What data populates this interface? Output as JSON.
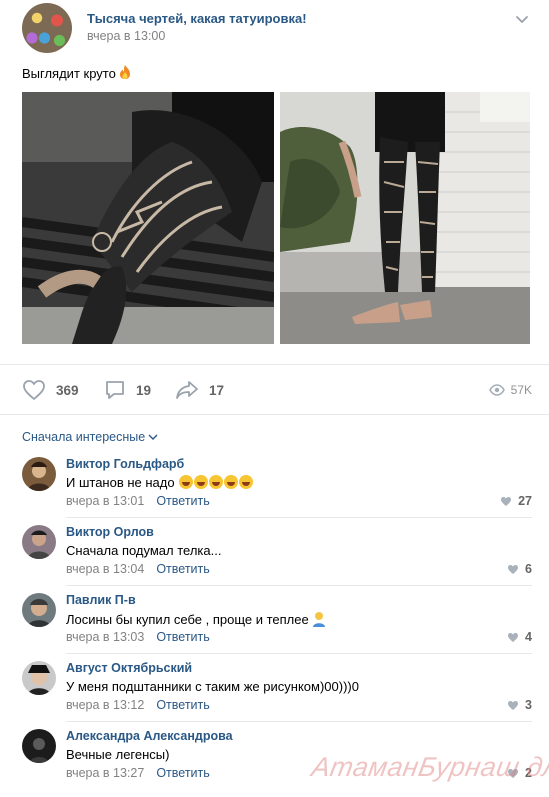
{
  "post": {
    "group_name": "Тысяча чертей, какая татуировка!",
    "time": "вчера в 13:00",
    "text": "Выглядит круто",
    "text_emoji": "fire-emoji"
  },
  "actions": {
    "likes": "369",
    "comments": "19",
    "shares": "17",
    "views": "57K"
  },
  "comments_sort": "Сначала интересные",
  "comments": [
    {
      "author": "Виктор Гольдфарб",
      "text": "И штанов не надо",
      "emojis": 5,
      "time": "вчера в 13:01",
      "reply": "Ответить",
      "likes": "27"
    },
    {
      "author": "Виктор Орлов",
      "text": "Сначала подумал телка...",
      "time": "вчера в 13:04",
      "reply": "Ответить",
      "likes": "6"
    },
    {
      "author": "Павлик П-в",
      "text": "Лосины бы купил себе , проще и теплее",
      "time": "вчера в 13:03",
      "reply": "Ответить",
      "likes": "4"
    },
    {
      "author": "Август Октябрьский",
      "text": "У меня подштанники с таким же рисунком)00)))0",
      "time": "вчера в 13:12",
      "reply": "Ответить",
      "likes": "3"
    },
    {
      "author": "Александра Александрова",
      "text": "Вечные легенсы)",
      "time": "вчера в 13:27",
      "reply": "Ответить",
      "likes": "2"
    }
  ],
  "watermark": "АтаманБурнаш для ЯП"
}
